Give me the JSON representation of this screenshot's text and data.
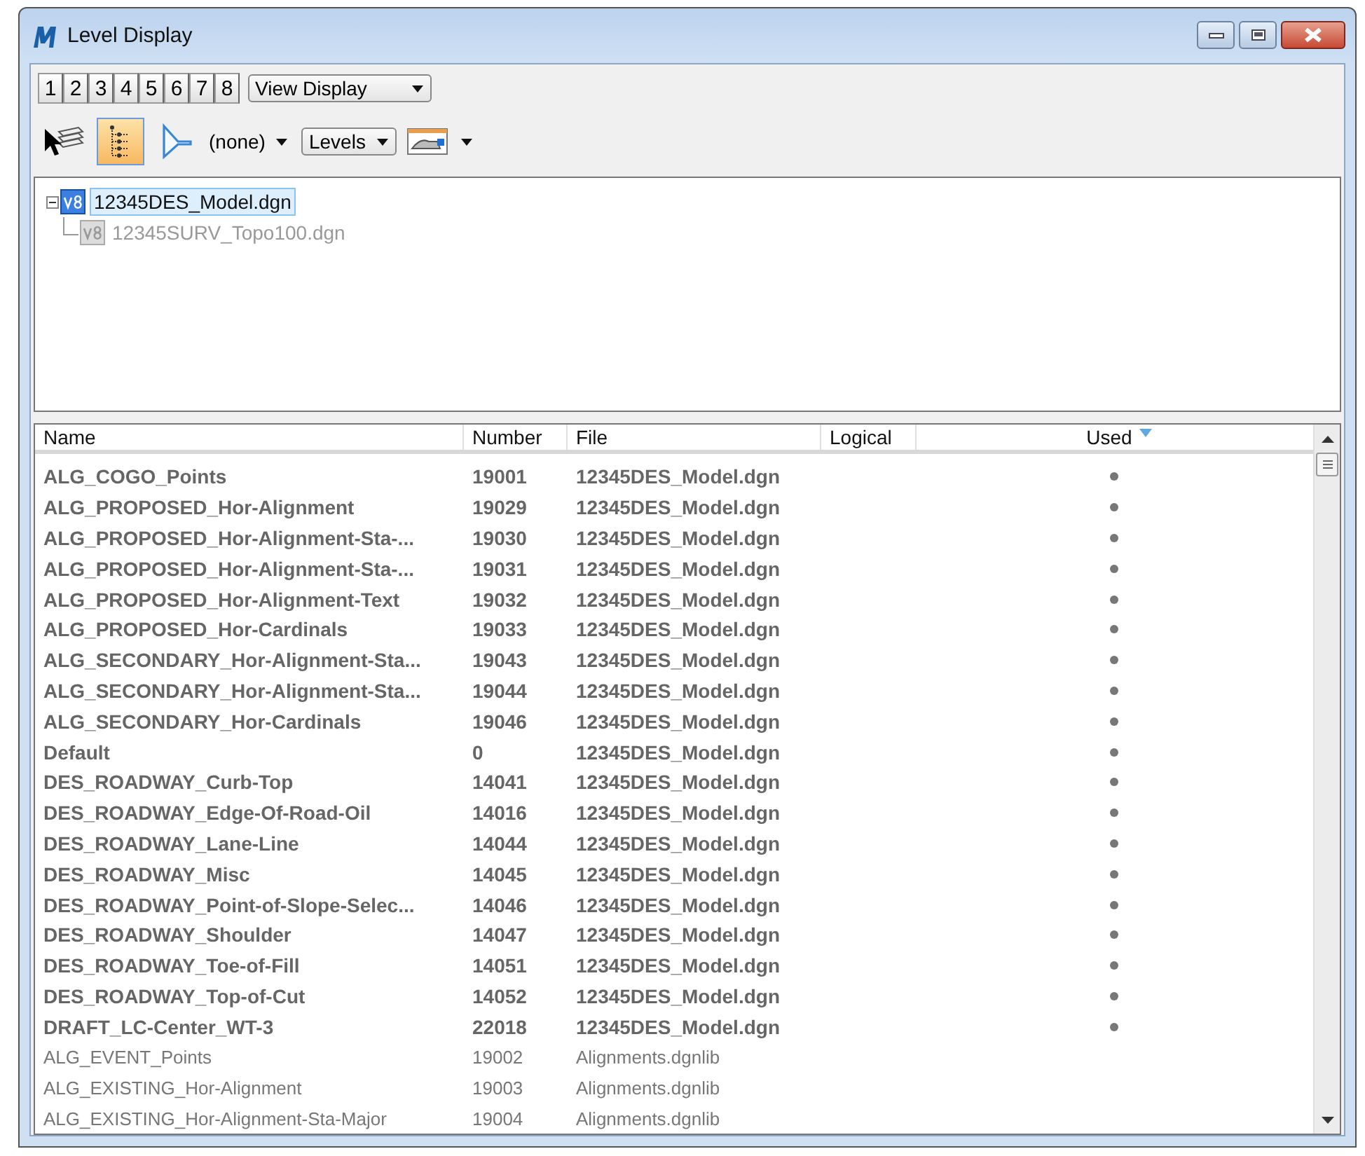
{
  "window": {
    "title": "Level Display"
  },
  "view_buttons": [
    "1",
    "2",
    "3",
    "4",
    "5",
    "6",
    "7",
    "8"
  ],
  "view_mode": {
    "value": "View Display"
  },
  "toolbar": [
    {
      "kind": "select-tool",
      "pressed": false
    },
    {
      "kind": "hierarchy",
      "pressed": true
    },
    {
      "kind": "filter",
      "pressed": false
    }
  ],
  "filter": {
    "value": "(none)"
  },
  "list_mode": {
    "value": "Levels"
  },
  "tree": [
    {
      "label": "12345DES_Model.dgn",
      "selected": true,
      "disabled": false,
      "expanded": true,
      "children": [
        {
          "label": "12345SURV_Topo100.dgn",
          "selected": false,
          "disabled": true
        }
      ]
    }
  ],
  "table": {
    "columns": [
      {
        "label": "Name",
        "sorted": false
      },
      {
        "label": "Number",
        "sorted": false
      },
      {
        "label": "File",
        "sorted": false
      },
      {
        "label": "Logical",
        "sorted": false
      },
      {
        "label": "Used",
        "sorted": true
      }
    ],
    "rows": [
      {
        "name": "ALG_COGO_Points",
        "number": "19001",
        "file": "12345DES_Model.dgn",
        "used": true
      },
      {
        "name": "ALG_PROPOSED_Hor-Alignment",
        "number": "19029",
        "file": "12345DES_Model.dgn",
        "used": true
      },
      {
        "name": "ALG_PROPOSED_Hor-Alignment-Sta-...",
        "number": "19030",
        "file": "12345DES_Model.dgn",
        "used": true
      },
      {
        "name": "ALG_PROPOSED_Hor-Alignment-Sta-...",
        "number": "19031",
        "file": "12345DES_Model.dgn",
        "used": true
      },
      {
        "name": "ALG_PROPOSED_Hor-Alignment-Text",
        "number": "19032",
        "file": "12345DES_Model.dgn",
        "used": true
      },
      {
        "name": "ALG_PROPOSED_Hor-Cardinals",
        "number": "19033",
        "file": "12345DES_Model.dgn",
        "used": true
      },
      {
        "name": "ALG_SECONDARY_Hor-Alignment-Sta...",
        "number": "19043",
        "file": "12345DES_Model.dgn",
        "used": true
      },
      {
        "name": "ALG_SECONDARY_Hor-Alignment-Sta...",
        "number": "19044",
        "file": "12345DES_Model.dgn",
        "used": true
      },
      {
        "name": "ALG_SECONDARY_Hor-Cardinals",
        "number": "19046",
        "file": "12345DES_Model.dgn",
        "used": true
      },
      {
        "name": "Default",
        "number": "0",
        "file": "12345DES_Model.dgn",
        "used": true
      },
      {
        "name": "DES_ROADWAY_Curb-Top",
        "number": "14041",
        "file": "12345DES_Model.dgn",
        "used": true
      },
      {
        "name": "DES_ROADWAY_Edge-Of-Road-Oil",
        "number": "14016",
        "file": "12345DES_Model.dgn",
        "used": true
      },
      {
        "name": "DES_ROADWAY_Lane-Line",
        "number": "14044",
        "file": "12345DES_Model.dgn",
        "used": true
      },
      {
        "name": "DES_ROADWAY_Misc",
        "number": "14045",
        "file": "12345DES_Model.dgn",
        "used": true
      },
      {
        "name": "DES_ROADWAY_Point-of-Slope-Selec...",
        "number": "14046",
        "file": "12345DES_Model.dgn",
        "used": true
      },
      {
        "name": "DES_ROADWAY_Shoulder",
        "number": "14047",
        "file": "12345DES_Model.dgn",
        "used": true
      },
      {
        "name": "DES_ROADWAY_Toe-of-Fill",
        "number": "14051",
        "file": "12345DES_Model.dgn",
        "used": true
      },
      {
        "name": "DES_ROADWAY_Top-of-Cut",
        "number": "14052",
        "file": "12345DES_Model.dgn",
        "used": true
      },
      {
        "name": "DRAFT_LC-Center_WT-3",
        "number": "22018",
        "file": "12345DES_Model.dgn",
        "used": true
      },
      {
        "name": "ALG_EVENT_Points",
        "number": "19002",
        "file": "Alignments.dgnlib",
        "used": false
      },
      {
        "name": "ALG_EXISTING_Hor-Alignment",
        "number": "19003",
        "file": "Alignments.dgnlib",
        "used": false
      },
      {
        "name": "ALG_EXISTING_Hor-Alignment-Sta-Major",
        "number": "19004",
        "file": "Alignments.dgnlib",
        "used": false
      }
    ]
  }
}
